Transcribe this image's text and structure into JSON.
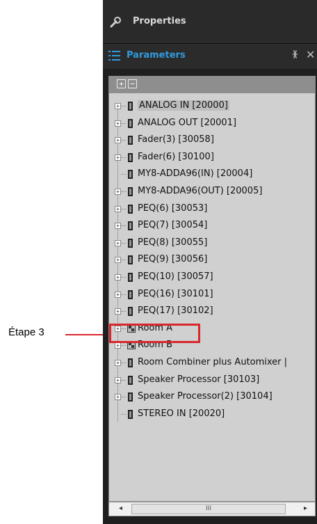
{
  "colors": {
    "accent": "#2f9be0",
    "callout": "#d9262d"
  },
  "properties": {
    "title": "Properties",
    "icon": "wrench-icon"
  },
  "parameters": {
    "title": "Parameters",
    "icon": "list-icon",
    "pin_icon": "pin-icon",
    "close_icon": "close-icon"
  },
  "toolbar": {
    "expand_all": "+",
    "collapse_all": "−"
  },
  "tree": {
    "items": [
      {
        "label": "ANALOG IN [20000]",
        "type": "component",
        "expandable": true,
        "selected": true
      },
      {
        "label": "ANALOG OUT [20001]",
        "type": "component",
        "expandable": true
      },
      {
        "label": "Fader(3) [30058]",
        "type": "component",
        "expandable": true
      },
      {
        "label": "Fader(6) [30100]",
        "type": "component",
        "expandable": true
      },
      {
        "label": "MY8-ADDA96(IN) [20004]",
        "type": "component",
        "expandable": false
      },
      {
        "label": "MY8-ADDA96(OUT) [20005]",
        "type": "component",
        "expandable": true
      },
      {
        "label": "PEQ(6) [30053]",
        "type": "component",
        "expandable": true
      },
      {
        "label": "PEQ(7) [30054]",
        "type": "component",
        "expandable": true
      },
      {
        "label": "PEQ(8) [30055]",
        "type": "component",
        "expandable": true
      },
      {
        "label": "PEQ(9) [30056]",
        "type": "component",
        "expandable": true
      },
      {
        "label": "PEQ(10) [30057]",
        "type": "component",
        "expandable": true
      },
      {
        "label": "PEQ(16) [30101]",
        "type": "component",
        "expandable": true
      },
      {
        "label": "PEQ(17) [30102]",
        "type": "component",
        "expandable": true
      },
      {
        "label": "Room A",
        "type": "room",
        "expandable": true
      },
      {
        "label": "Room B",
        "type": "room",
        "expandable": true
      },
      {
        "label": "Room Combiner plus Automixer |",
        "type": "component",
        "expandable": true
      },
      {
        "label": "Speaker Processor [30103]",
        "type": "component",
        "expandable": true
      },
      {
        "label": "Speaker Processor(2) [30104]",
        "type": "component",
        "expandable": true
      },
      {
        "label": "STEREO IN [20020]",
        "type": "component",
        "expandable": false
      }
    ]
  },
  "scrollbar": {
    "left_icon": "arrow-left-icon",
    "right_icon": "arrow-right-icon",
    "grip": "III"
  },
  "callout": {
    "label": "Étape 3"
  }
}
